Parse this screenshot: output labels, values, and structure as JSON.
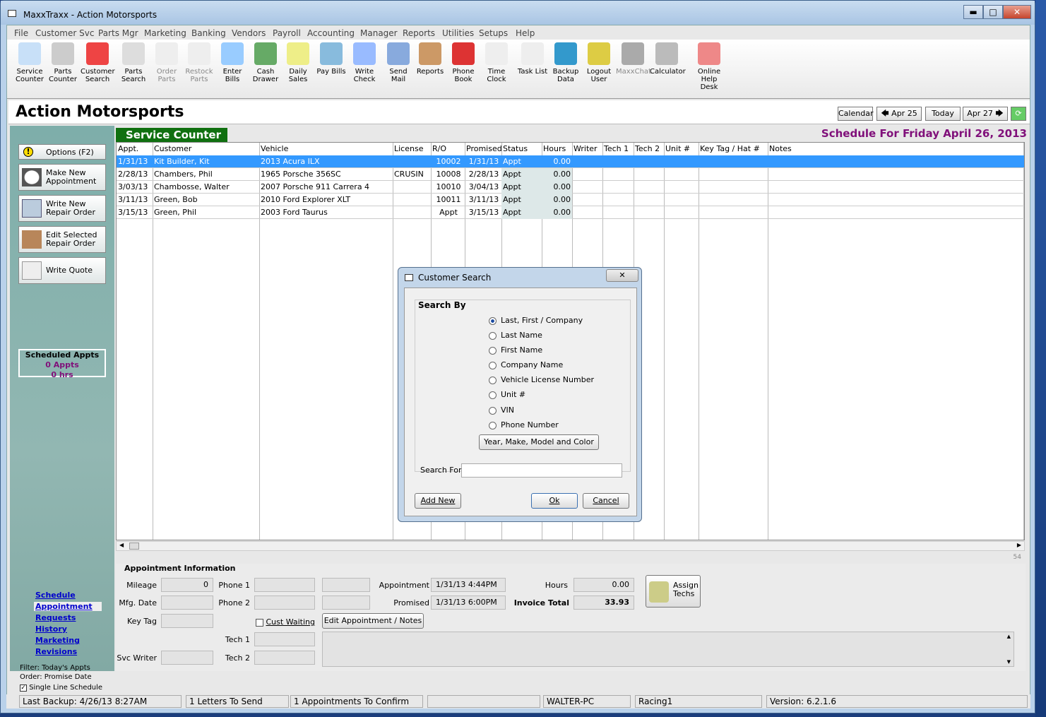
{
  "window": {
    "title": "MaxxTraxx - Action Motorsports",
    "min": "▬",
    "max": "□",
    "close": "✕"
  },
  "menu": [
    "File",
    "Customer Svc",
    "Parts Mgr",
    "Marketing",
    "Banking",
    "Vendors",
    "Payroll",
    "Accounting",
    "Manager",
    "Reports",
    "Utilities",
    "Setups",
    "Help"
  ],
  "toolbar": [
    {
      "l1": "Service",
      "l2": "Counter",
      "icon": "clock-icon",
      "color": "#c8e0f8"
    },
    {
      "l1": "Parts",
      "l2": "Counter",
      "icon": "tire-icon",
      "color": "#ccc"
    },
    {
      "l1": "Customer",
      "l2": "Search",
      "icon": "car-icon",
      "color": "#e44"
    },
    {
      "l1": "Parts",
      "l2": "Search",
      "icon": "wheel-icon",
      "color": "#ddd"
    },
    {
      "l1": "Order",
      "l2": "Parts",
      "icon": "order-icon",
      "color": "#eee",
      "dim": true
    },
    {
      "l1": "Restock",
      "l2": "Parts",
      "icon": "restock-icon",
      "color": "#eee",
      "dim": true
    },
    {
      "l1": "Enter Bills",
      "l2": "",
      "icon": "bills-icon",
      "color": "#9cf"
    },
    {
      "l1": "Cash",
      "l2": "Drawer",
      "icon": "money-bag-icon",
      "color": "#6a6"
    },
    {
      "l1": "Daily",
      "l2": "Sales",
      "icon": "sales-icon",
      "color": "#ee8"
    },
    {
      "l1": "Pay Bills",
      "l2": "",
      "icon": "pay-icon",
      "color": "#8bd"
    },
    {
      "l1": "Write",
      "l2": "Check",
      "icon": "check-icon",
      "color": "#9bf"
    },
    {
      "l1": "Send Mail",
      "l2": "",
      "icon": "mail-icon",
      "color": "#8ad"
    },
    {
      "l1": "Reports",
      "l2": "",
      "icon": "clipboard-icon",
      "color": "#c96"
    },
    {
      "l1": "Phone",
      "l2": "Book",
      "icon": "phone-icon",
      "color": "#d33"
    },
    {
      "l1": "Time",
      "l2": "Clock",
      "icon": "stopwatch-icon",
      "color": "#eee"
    },
    {
      "l1": "Task List",
      "l2": "",
      "icon": "tasklist-icon",
      "color": "#eee"
    },
    {
      "l1": "Backup",
      "l2": "Data",
      "icon": "disk-icon",
      "color": "#39c"
    },
    {
      "l1": "Logout",
      "l2": "User",
      "icon": "lock-icon",
      "color": "#dc4"
    },
    {
      "l1": "MaxxChat",
      "l2": "",
      "icon": "chat-icon",
      "color": "#aaa",
      "dim": true
    },
    {
      "l1": "Calculator",
      "l2": "",
      "icon": "calculator-icon",
      "color": "#bbb"
    },
    {
      "l1": "Online",
      "l2": "Help Desk",
      "icon": "headset-icon",
      "color": "#e88"
    }
  ],
  "header": {
    "business": "Action Motorsports",
    "calendar": "Calendar",
    "prev": "Apr 25",
    "today": "Today",
    "next": "Apr 27"
  },
  "left": {
    "options": "Options (F2)",
    "make_new_1": "Make  New",
    "make_new_2": "Appointment",
    "write_ro_1": "Write New",
    "write_ro_2": "Repair Order",
    "edit_ro_1": "Edit Selected",
    "edit_ro_2": "Repair Order",
    "quote": "Write Quote",
    "sched_title": "Scheduled Appts",
    "sched_appts": "0 Appts",
    "sched_hrs": "0 hrs",
    "links": [
      "Schedule",
      "Appointment",
      "Requests",
      "History",
      "Marketing",
      "Revisions"
    ],
    "filter": "Filter: Today's Appts",
    "order": "Order: Promise Date",
    "single_line": "Single Line Schedule"
  },
  "main": {
    "title": "Service Counter",
    "schedule": "Schedule For Friday  April 26, 2013",
    "scroll_num": "54"
  },
  "columns": [
    "Appt.",
    "Customer",
    "Vehicle",
    "License",
    "R/O",
    "Promised",
    "Status",
    "Hours",
    "Writer",
    "Tech 1",
    "Tech 2",
    "Unit #",
    "Key Tag / Hat #",
    "Notes"
  ],
  "rows": [
    [
      "1/31/13",
      "Kit Builder, Kit",
      "2013 Acura  ILX",
      "",
      "10002",
      "1/31/13",
      "Appt",
      "0.00"
    ],
    [
      "2/28/13",
      "Chambers, Phil",
      "1965 Porsche  356SC",
      "CRUSIN",
      "10008",
      "2/28/13",
      "Appt",
      "0.00"
    ],
    [
      "3/03/13",
      "Chambosse, Walter",
      "2007 Porsche  911 Carrera 4",
      "",
      "10010",
      "3/04/13",
      "Appt",
      "0.00"
    ],
    [
      "3/11/13",
      "Green, Bob",
      "2010 Ford  Explorer XLT",
      "",
      "10011",
      "3/11/13",
      "Appt",
      "0.00"
    ],
    [
      "3/15/13",
      "Green, Phil",
      "2003 Ford  Taurus",
      "",
      "Appt",
      "3/15/13",
      "Appt",
      "0.00"
    ]
  ],
  "dialog": {
    "title": "Customer Search",
    "search_by": "Search By",
    "options": [
      "Last, First / Company",
      "Last Name",
      "First Name",
      "Company Name",
      "Vehicle License Number",
      "Unit #",
      "VIN",
      "Phone Number"
    ],
    "ymm": "Year, Make, Model and Color",
    "search_for": "Search For",
    "search_value": "",
    "add": "Add New",
    "ok": "Ok",
    "cancel": "Cancel"
  },
  "appt": {
    "title": "Appointment Information",
    "mileage_l": "Mileage",
    "mileage": "0",
    "mfg_l": "Mfg. Date",
    "keytag_l": "Key Tag",
    "svc_l": "Svc Writer",
    "phone1_l": "Phone 1",
    "phone2_l": "Phone 2",
    "cust_waiting": "Cust Waiting",
    "tech1_l": "Tech 1",
    "tech2_l": "Tech 2",
    "appt_l": "Appointment",
    "appt_v": "1/31/13  4:44PM",
    "prom_l": "Promised",
    "prom_v": "1/31/13  6:00PM",
    "edit": "Edit Appointment / Notes",
    "hours_l": "Hours",
    "hours_v": "0.00",
    "inv_l": "Invoice Total",
    "inv_v": "33.93",
    "assign_1": "Assign",
    "assign_2": "Techs"
  },
  "status": [
    "Last Backup:  4/26/13   8:27AM",
    "1 Letters To Send",
    "1 Appointments To Confirm",
    "",
    "WALTER-PC",
    "Racing1",
    "Version:  6.2.1.6"
  ]
}
